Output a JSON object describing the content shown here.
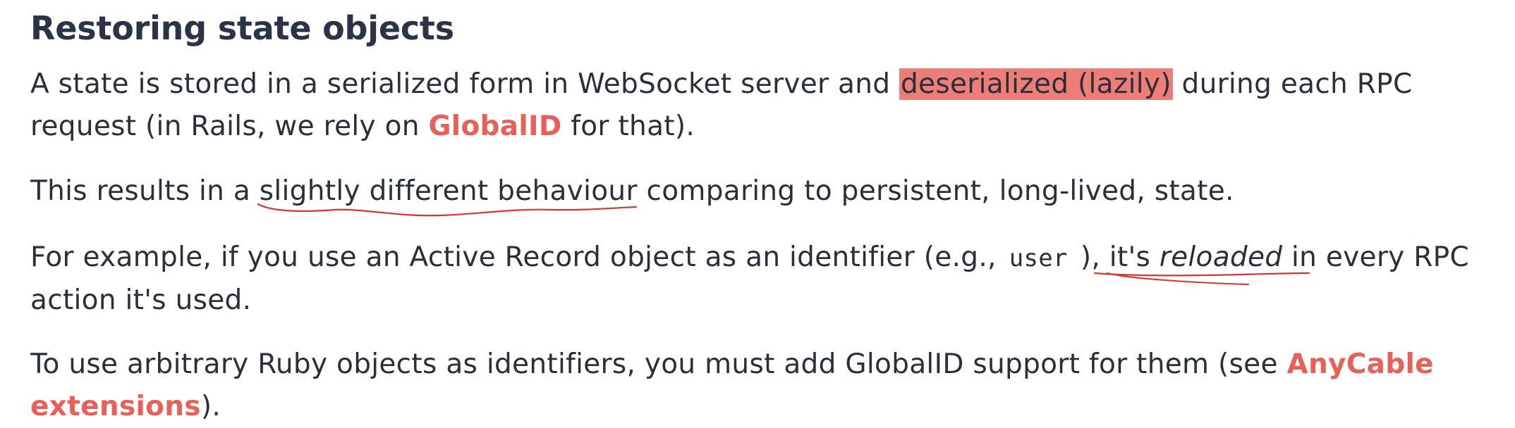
{
  "heading": "Restoring state objects",
  "p1": {
    "t1": "A state is stored in a serialized form in WebSocket server and ",
    "highlight": "deserialized (lazily)",
    "t2": " during each RPC",
    "t3": "request (in Rails, we rely on ",
    "link": "GlobalID",
    "t4": " for that)."
  },
  "p2": {
    "t1": "This results in a ",
    "underlined": "slightly different behaviour",
    "t2": " comparing to persistent, long-lived, state."
  },
  "p3": {
    "t1": "For example, if you use an Active Record object as an identifier (e.g.,",
    "code": "user",
    "t2": "), it's ",
    "em": "reloaded",
    "t3": " in every RPC",
    "t4": "action it's used."
  },
  "p4": {
    "t1": "To use arbitrary Ruby objects as identifiers, you must add GlobalID support for them (see ",
    "link": "AnyCable",
    "link2": "extensions",
    "t2": ")."
  },
  "colors": {
    "text": "#2a2f3a",
    "heading": "#2b3346",
    "link": "#e8605a",
    "highlight": "#ef7d77",
    "annotation": "#d9352e"
  }
}
